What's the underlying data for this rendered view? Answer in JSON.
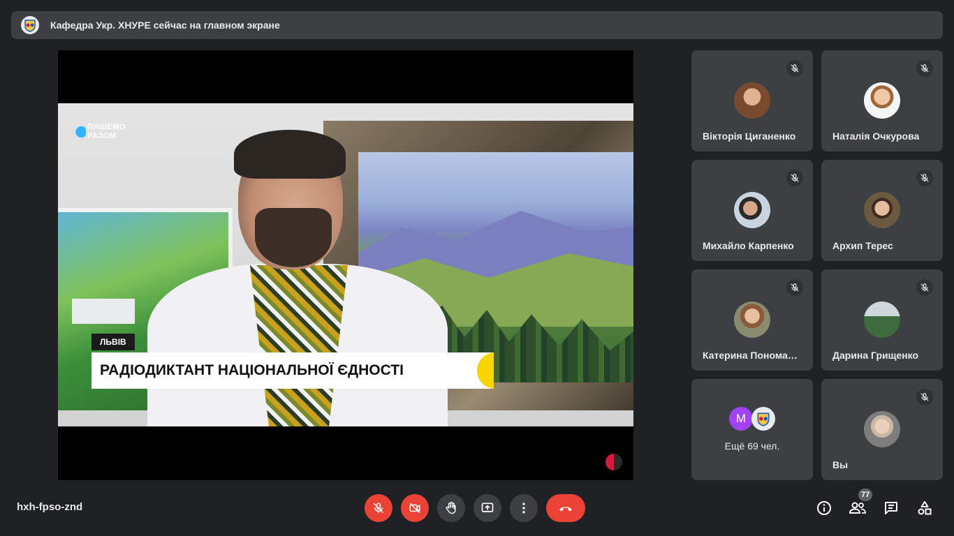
{
  "banner": {
    "text": "Кафедра Укр. ХНУРЕ сейчас на главном экране",
    "logo_icon": "university-crest-icon"
  },
  "presentation": {
    "brand_line1": "ПИШЕМО",
    "brand_line2": "РАЗОМ",
    "location_tag": "ЛЬВІВ",
    "headline": "РАДІОДИКТАНТ НАЦІОНАЛЬНОЇ ЄДНОСТІ"
  },
  "participants": [
    {
      "name": "Вікторія Циганенко",
      "muted": true,
      "avatar_color": "#7a4a2e"
    },
    {
      "name": "Наталія Очкурова",
      "muted": true,
      "avatar_color": "#3b6fb6"
    },
    {
      "name": "Михайло Карпенко",
      "muted": true,
      "avatar_color": "#6d7f95"
    },
    {
      "name": "Архип Терес",
      "muted": true,
      "avatar_color": "#6b5a3e"
    },
    {
      "name": "Катерина Пономар…",
      "muted": true,
      "avatar_color": "#8a6f55"
    },
    {
      "name": "Дарина Грищенко",
      "muted": true,
      "avatar_color": "#3e6b3e"
    }
  ],
  "more_tile": {
    "initial": "M",
    "text": "Ещё 69 чел."
  },
  "self_tile": {
    "name": "Вы",
    "muted": true
  },
  "bottom_bar": {
    "meeting_code": "hxh-fpso-znd",
    "participants_count": "77"
  },
  "colors": {
    "background": "#202124",
    "tile": "#3c4043",
    "danger": "#ea4335",
    "accent_yellow": "#f6d500"
  }
}
